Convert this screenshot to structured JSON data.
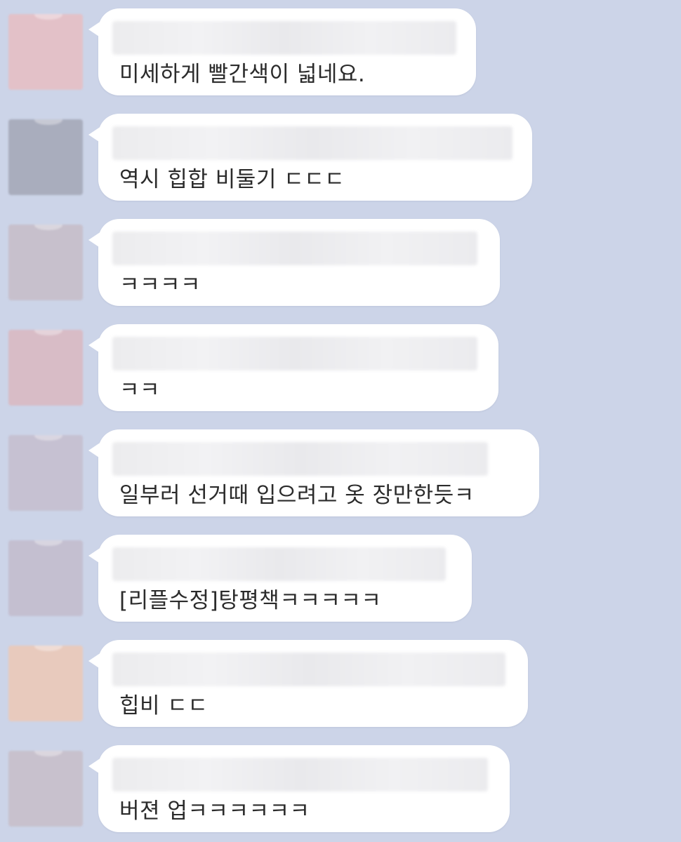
{
  "chat": {
    "messages": [
      {
        "text": "미세하게 빨간색이 넓네요.",
        "avatar_color": "#e3c1c8"
      },
      {
        "text": "역시 힙합 비둘기 ㄷㄷㄷ",
        "avatar_color": "#a9adbd"
      },
      {
        "text": "ㅋㅋㅋㅋ",
        "avatar_color": "#c7c0cc"
      },
      {
        "text": "ㅋㅋ",
        "avatar_color": "#d8bcc6"
      },
      {
        "text": "일부러 선거때 입으려고 옷 장만한듯ㅋ",
        "avatar_color": "#c6c1d2"
      },
      {
        "text": "[리플수정]탕평책ㅋㅋㅋㅋㅋ",
        "avatar_color": "#c4bfd0"
      },
      {
        "text": "힙비 ㄷㄷ",
        "avatar_color": "#e8cabd"
      },
      {
        "text": "버젼 업ㅋㅋㅋㅋㅋㅋ",
        "avatar_color": "#c8c1cd"
      }
    ]
  }
}
